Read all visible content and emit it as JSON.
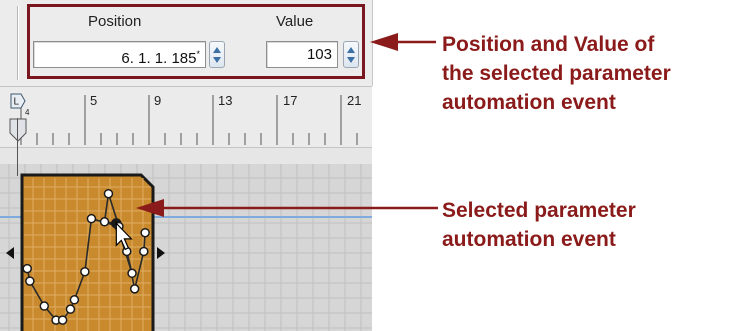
{
  "toolbar": {
    "position": {
      "label": "Position",
      "value": "6. 1. 1. 185",
      "suffix": "*"
    },
    "value": {
      "label": "Value",
      "value": "103"
    }
  },
  "ruler": {
    "bar_numbers": [
      "5",
      "9",
      "13",
      "17",
      "21"
    ],
    "loop_marker_label": "L",
    "loop_marker_sub": "4"
  },
  "automation": {
    "points": [
      [
        0.04,
        0.6
      ],
      [
        0.06,
        0.68
      ],
      [
        0.17,
        0.84
      ],
      [
        0.26,
        0.93
      ],
      [
        0.31,
        0.93
      ],
      [
        0.37,
        0.86
      ],
      [
        0.4,
        0.8
      ],
      [
        0.48,
        0.62
      ],
      [
        0.53,
        0.28
      ],
      [
        0.63,
        0.3
      ],
      [
        0.66,
        0.12
      ],
      [
        0.72,
        0.31
      ],
      [
        0.8,
        0.49
      ],
      [
        0.86,
        0.73
      ],
      [
        0.93,
        0.49
      ],
      [
        0.94,
        0.37
      ],
      [
        0.84,
        0.63
      ],
      [
        0.74,
        0.33
      ]
    ],
    "selected_index": 11,
    "colors": {
      "clip_fill": "#c98a2e",
      "clip_border": "#1a1a1a",
      "line": "#2a2a2a",
      "grid_line": "#7eaadc"
    }
  },
  "callouts": {
    "top_text": [
      "Position and Value of",
      "the selected parameter",
      "automation event"
    ],
    "bottom_text": [
      "Selected parameter",
      "automation event"
    ],
    "color": "#8b1a1a"
  }
}
